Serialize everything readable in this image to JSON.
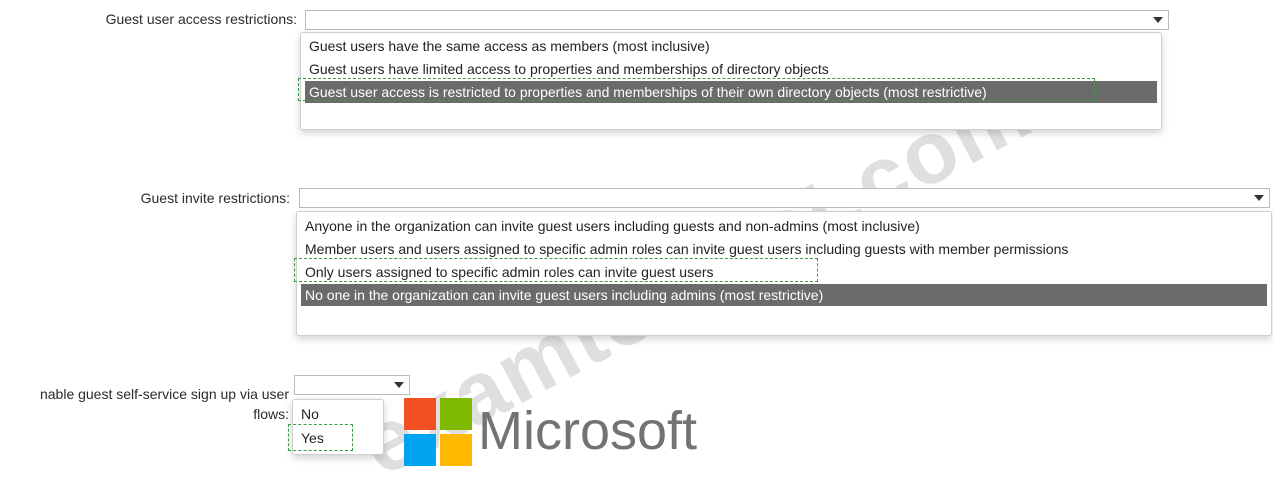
{
  "guest_access": {
    "label": "Guest user access restrictions:",
    "selected_value": "",
    "options": [
      "Guest users have the same access as members (most inclusive)",
      "Guest users have limited access to properties and memberships of directory objects",
      "Guest user access is restricted to properties and memberships of their own directory objects (most restrictive)"
    ]
  },
  "guest_invite": {
    "label": "Guest invite restrictions:",
    "selected_value": "",
    "options": [
      "Anyone in the organization can invite guest users including guests and non-admins (most inclusive)",
      "Member users and users assigned to specific admin roles can invite guest users including guests with member permissions",
      "Only users assigned to specific admin roles can invite guest users",
      "No one in the organization can invite guest users including admins (most restrictive)"
    ]
  },
  "self_service": {
    "label_line1": "nable guest self-service sign up via user",
    "label_line2": "flows:",
    "selected_value": "",
    "options": [
      "No",
      "Yes"
    ]
  },
  "watermark": "examtorrent.com",
  "logo": {
    "text": "Microsoft",
    "colors": [
      "#f25022",
      "#7fba00",
      "#00a4ef",
      "#ffb900"
    ]
  },
  "colors": {
    "highlight": "#6b6b6b",
    "dashed_marker": "#3a9a4a"
  }
}
